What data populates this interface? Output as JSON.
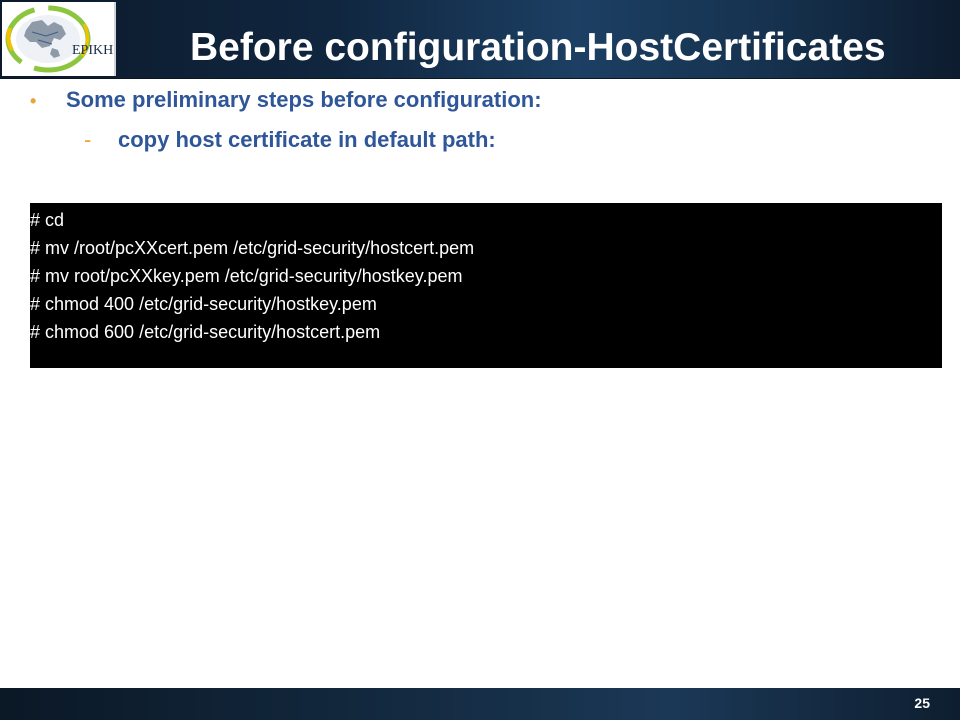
{
  "header": {
    "title": "Before configuration-HostCertificates",
    "logo_text": "EPIKH"
  },
  "content": {
    "bullet": "Some preliminary steps before configuration:",
    "sub_bullet": "copy host certificate in default path:",
    "bullet_marker": "•",
    "sub_bullet_marker": "-"
  },
  "terminal": {
    "lines": [
      "# cd",
      "# mv /root/pcXXcert.pem /etc/grid-security/hostcert.pem",
      "# mv root/pcXXkey.pem /etc/grid-security/hostkey.pem",
      "# chmod 400 /etc/grid-security/hostkey.pem",
      "# chmod 600 /etc/grid-security/hostcert.pem"
    ]
  },
  "footer": {
    "page_number": "25"
  },
  "colors": {
    "title_text": "#ffffff",
    "bullet_text": "#2e5699",
    "bullet_marker": "#e8a33a",
    "terminal_bg": "#000000",
    "terminal_text": "#ffffff"
  }
}
